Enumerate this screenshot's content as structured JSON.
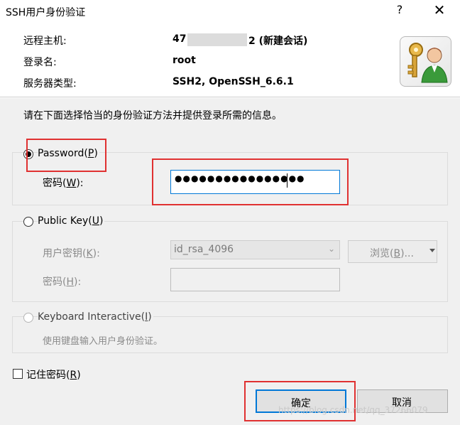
{
  "window": {
    "title": "SSH用户身份验证",
    "help_label": "?",
    "close_label": "✕"
  },
  "info": {
    "host_label": "远程主机:",
    "host_value_prefix": "47",
    "host_value_suffix": "2 (新建会话)",
    "login_label": "登录名:",
    "login_value": "root",
    "server_type_label": "服务器类型:",
    "server_type_value": "SSH2, OpenSSH_6.6.1",
    "avatar_icon": "user-key-icon"
  },
  "instruction": "请在下面选择恰当的身份验证方法并提供登录所需的信息。",
  "password_method": {
    "radio_label": "Password(",
    "radio_accel": "P",
    "radio_close": ")",
    "selected": true,
    "field_label": "密码(",
    "field_accel": "W",
    "field_close": "):",
    "field_value": "●●●●●●●●●●●●●●●●"
  },
  "public_key_method": {
    "radio_label": "Public Key(",
    "radio_accel": "U",
    "radio_close": ")",
    "user_key_label": "用户密钥(",
    "user_key_accel": "K",
    "user_key_close": "):",
    "user_key_value": "id_rsa_4096",
    "browse_label": "浏览(",
    "browse_accel": "B",
    "browse_close": ")...",
    "passphrase_label": "密码(",
    "passphrase_accel": "H",
    "passphrase_close": "):",
    "passphrase_value": ""
  },
  "keyboard_method": {
    "radio_label": "Keyboard Interactive(",
    "radio_accel": "I",
    "radio_close": ")",
    "hint": "使用键盘输入用户身份验证。"
  },
  "remember": {
    "label": "记住密码(",
    "accel": "R",
    "close": ")"
  },
  "buttons": {
    "ok_label": "确定",
    "cancel_label": "取消"
  },
  "watermark": "https://blog.csdn.net/qq_37266079",
  "colors": {
    "highlight_border": "#e03131",
    "focus_border": "#0078d7",
    "dialog_background": "#f0f0f0"
  }
}
